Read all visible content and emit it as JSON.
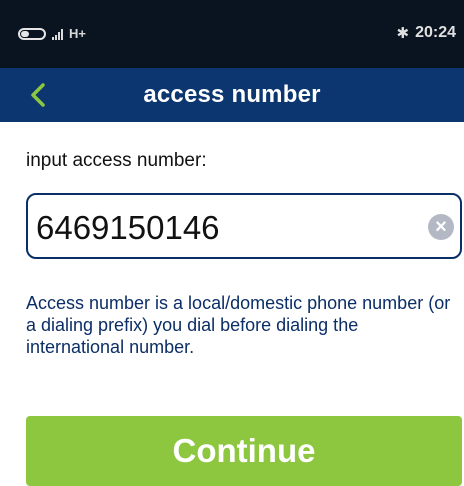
{
  "status_bar": {
    "network": "H+",
    "time": "20:24",
    "icons": [
      "toggle-icon",
      "signal-icon",
      "bluetooth-icon"
    ]
  },
  "header": {
    "back_icon": "chevron-left-icon",
    "title": "access number"
  },
  "form": {
    "label": "input access number:",
    "input_value": "6469150146",
    "clear_icon": "clear-icon"
  },
  "help_text": "Access number is a local/domestic phone number (or a dialing prefix) you dial before dialing the international number.",
  "continue_label": "Continue",
  "colors": {
    "status_bar_bg": "#0a1420",
    "header_bg": "#0b3670",
    "accent_green": "#8dc63f",
    "help_text": "#0c2e66"
  }
}
